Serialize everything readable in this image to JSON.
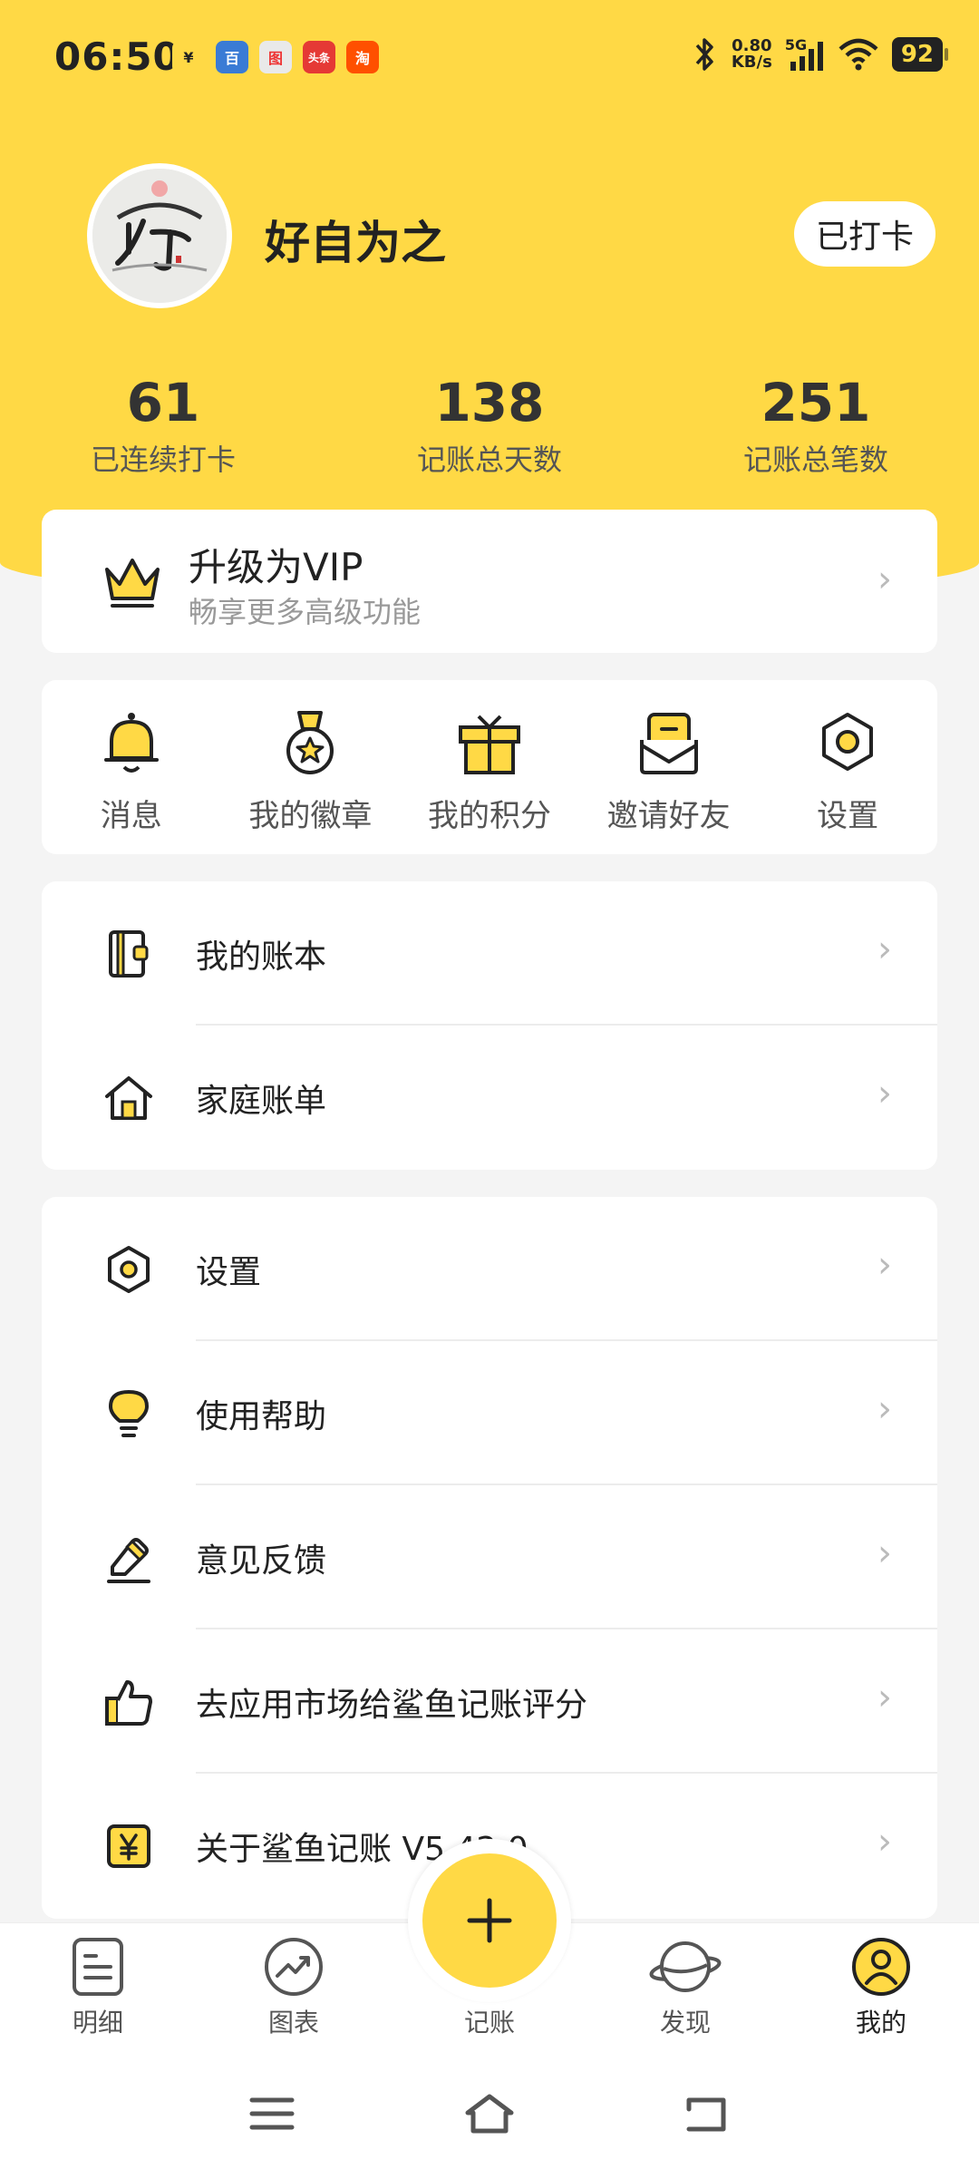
{
  "status_bar": {
    "time": "06:50",
    "network_speed_value": "0.80",
    "network_speed_unit": "KB/s",
    "network_type": "5G",
    "battery": "92",
    "notif_labels": [
      "¥",
      "百",
      "图",
      "头条",
      "淘"
    ]
  },
  "profile": {
    "username": "好自为之",
    "checkin_label": "已打卡",
    "avatar_icon": "ink-painting-avatar"
  },
  "stats": [
    {
      "value": "61",
      "label": "已连续打卡"
    },
    {
      "value": "138",
      "label": "记账总天数"
    },
    {
      "value": "251",
      "label": "记账总笔数"
    }
  ],
  "vip": {
    "title": "升级为VIP",
    "subtitle": "畅享更多高级功能",
    "icon": "crown-icon"
  },
  "quick_actions": [
    {
      "label": "消息",
      "icon": "bell-icon"
    },
    {
      "label": "我的徽章",
      "icon": "medal-icon"
    },
    {
      "label": "我的积分",
      "icon": "gift-icon"
    },
    {
      "label": "邀请好友",
      "icon": "envelope-icon"
    },
    {
      "label": "设置",
      "icon": "settings-icon"
    }
  ],
  "menu_group1": [
    {
      "label": "我的账本",
      "icon": "ledger-icon"
    },
    {
      "label": "家庭账单",
      "icon": "home-icon"
    }
  ],
  "menu_group2": [
    {
      "label": "设置",
      "icon": "settings-icon"
    },
    {
      "label": "使用帮助",
      "icon": "lightbulb-icon"
    },
    {
      "label": "意见反馈",
      "icon": "edit-icon"
    },
    {
      "label": "去应用市场给鲨鱼记账评分",
      "icon": "thumbs-up-icon"
    },
    {
      "label": "关于鲨鱼记账 V5.42.0",
      "icon": "yuan-icon"
    }
  ],
  "bottom_nav": [
    {
      "label": "明细",
      "icon": "list-icon"
    },
    {
      "label": "图表",
      "icon": "chart-icon"
    },
    {
      "label": "记账",
      "icon": "plus-icon"
    },
    {
      "label": "发现",
      "icon": "planet-icon"
    },
    {
      "label": "我的",
      "icon": "user-icon"
    }
  ],
  "colors": {
    "accent": "#ffd945",
    "background": "#f4f4f4",
    "card": "#ffffff",
    "text_primary": "#222222",
    "text_secondary": "#999999"
  }
}
